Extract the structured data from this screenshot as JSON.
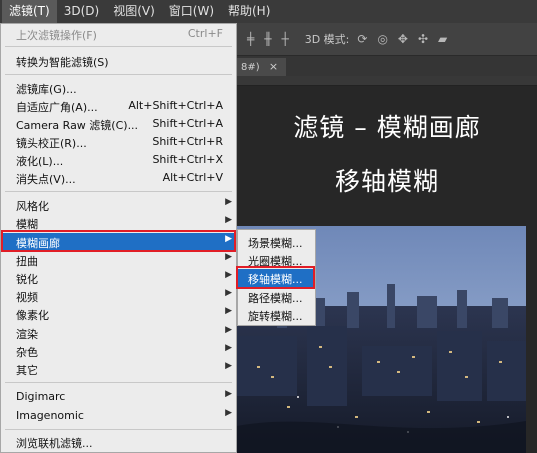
{
  "menubar": {
    "items": [
      "滤镜(T)",
      "3D(D)",
      "视图(V)",
      "窗口(W)",
      "帮助(H)"
    ]
  },
  "options_bar": {
    "mode_label": "3D 模式:"
  },
  "document_tab": {
    "label": "8#)",
    "close": "×"
  },
  "canvas": {
    "line1": "滤镜 – 模糊画廊",
    "line2": "移轴模糊"
  },
  "filter_menu": {
    "items": [
      {
        "label": "上次滤镜操作(F)",
        "shortcut": "Ctrl+F",
        "disabled": true
      },
      {
        "label": "转换为智能滤镜(S)",
        "shortcut": ""
      },
      {
        "label": "滤镜库(G)...",
        "shortcut": ""
      },
      {
        "label": "自适应广角(A)...",
        "shortcut": "Alt+Shift+Ctrl+A"
      },
      {
        "label": "Camera Raw 滤镜(C)...",
        "shortcut": "Shift+Ctrl+A"
      },
      {
        "label": "镜头校正(R)...",
        "shortcut": "Shift+Ctrl+R"
      },
      {
        "label": "液化(L)...",
        "shortcut": "Shift+Ctrl+X"
      },
      {
        "label": "消失点(V)...",
        "shortcut": "Alt+Ctrl+V"
      },
      {
        "label": "风格化",
        "shortcut": ""
      },
      {
        "label": "模糊",
        "shortcut": ""
      },
      {
        "label": "模糊画廊",
        "shortcut": ""
      },
      {
        "label": "扭曲",
        "shortcut": ""
      },
      {
        "label": "锐化",
        "shortcut": ""
      },
      {
        "label": "视频",
        "shortcut": ""
      },
      {
        "label": "像素化",
        "shortcut": ""
      },
      {
        "label": "渲染",
        "shortcut": ""
      },
      {
        "label": "杂色",
        "shortcut": ""
      },
      {
        "label": "其它",
        "shortcut": ""
      },
      {
        "label": "Digimarc",
        "shortcut": ""
      },
      {
        "label": "Imagenomic",
        "shortcut": ""
      },
      {
        "label": "浏览联机滤镜...",
        "shortcut": ""
      }
    ]
  },
  "blur_gallery_submenu": {
    "items": [
      "场景模糊...",
      "光圈模糊...",
      "移轴模糊...",
      "路径模糊...",
      "旋转模糊..."
    ]
  },
  "colors": {
    "highlight": "#1f6fc5",
    "annotation_red": "#e11d26"
  }
}
